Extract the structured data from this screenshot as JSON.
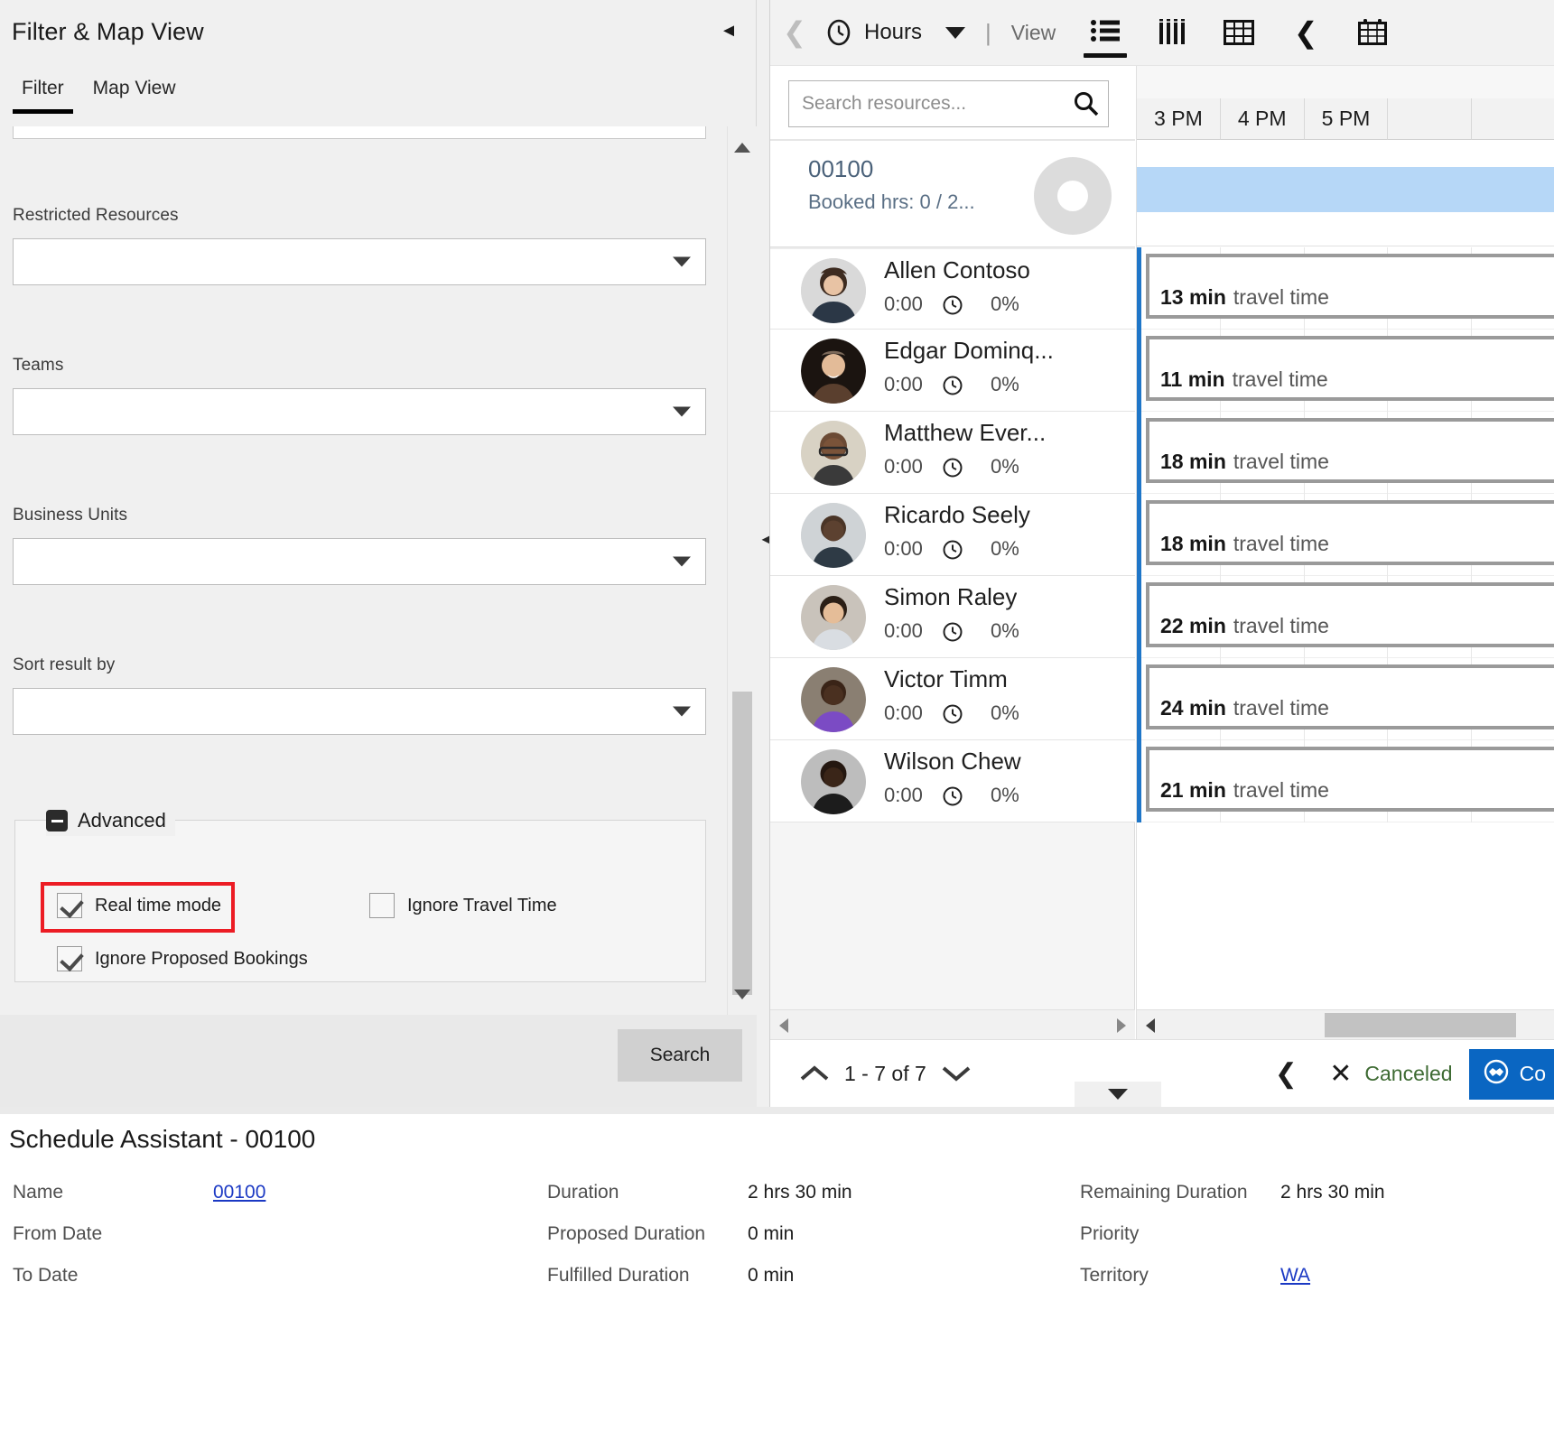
{
  "filter_panel": {
    "title": "Filter & Map View",
    "collapse_icon": "chevron-left-icon",
    "tabs": [
      {
        "label": "Filter",
        "active": true
      },
      {
        "label": "Map View",
        "active": false
      }
    ],
    "fields": [
      {
        "label": "Restricted Resources",
        "value": ""
      },
      {
        "label": "Teams",
        "value": ""
      },
      {
        "label": "Business Units",
        "value": ""
      },
      {
        "label": "Sort result by",
        "value": ""
      }
    ],
    "advanced": {
      "legend": "Advanced",
      "checkboxes": [
        {
          "label": "Real time mode",
          "checked": true,
          "highlighted": true
        },
        {
          "label": "Ignore Travel Time",
          "checked": false,
          "highlighted": false
        },
        {
          "label": "Ignore Proposed Bookings",
          "checked": true,
          "highlighted": false
        }
      ]
    },
    "footer": {
      "search_label": "Search"
    }
  },
  "schedule": {
    "toolbar": {
      "back_icon": "chevron-left-icon",
      "clock_icon": "clock-icon",
      "unit_label": "Hours",
      "dropdown_icon": "chevron-down-icon",
      "separator": "|",
      "view_label": "View",
      "icons": [
        {
          "name": "list-view-icon",
          "selected": true
        },
        {
          "name": "columns-view-icon",
          "selected": false
        },
        {
          "name": "grid-view-icon",
          "selected": false
        },
        {
          "name": "previous-icon",
          "selected": false
        },
        {
          "name": "calendar-icon",
          "selected": false
        }
      ]
    },
    "search": {
      "placeholder": "Search resources...",
      "value": "",
      "icon": "search-icon"
    },
    "requirement": {
      "name": "00100",
      "booked_hours": "Booked hrs: 0 / 2...",
      "avatar_icon": "requirement-avatar-icon"
    },
    "resources": [
      {
        "name": "Allen Contoso",
        "hours": "0:00",
        "percent": "0%",
        "clock_icon": "clock-icon"
      },
      {
        "name": "Edgar Dominq...",
        "hours": "0:00",
        "percent": "0%",
        "clock_icon": "clock-icon"
      },
      {
        "name": "Matthew Ever...",
        "hours": "0:00",
        "percent": "0%",
        "clock_icon": "clock-icon"
      },
      {
        "name": "Ricardo Seely",
        "hours": "0:00",
        "percent": "0%",
        "clock_icon": "clock-icon"
      },
      {
        "name": "Simon Raley",
        "hours": "0:00",
        "percent": "0%",
        "clock_icon": "clock-icon"
      },
      {
        "name": "Victor Timm",
        "hours": "0:00",
        "percent": "0%",
        "clock_icon": "clock-icon"
      },
      {
        "name": "Wilson Chew",
        "hours": "0:00",
        "percent": "0%",
        "clock_icon": "clock-icon"
      }
    ],
    "timeline": {
      "hour_labels": [
        "3 PM",
        "4 PM",
        "5 PM"
      ],
      "travel_blocks": [
        {
          "minutes": "13 min",
          "label": "travel time"
        },
        {
          "minutes": "11 min",
          "label": "travel time"
        },
        {
          "minutes": "18 min",
          "label": "travel time"
        },
        {
          "minutes": "18 min",
          "label": "travel time"
        },
        {
          "minutes": "22 min",
          "label": "travel time"
        },
        {
          "minutes": "24 min",
          "label": "travel time"
        },
        {
          "minutes": "21 min",
          "label": "travel time"
        }
      ],
      "highlight_color": "#b6d7f7",
      "lead_color": "#1f76c8"
    },
    "footer": {
      "up_icon": "chevron-up-icon",
      "paging_text": "1 - 7 of 7",
      "down_icon": "chevron-down-icon",
      "prev_icon": "chevron-left-icon",
      "cancel_icon": "close-icon",
      "cancel_label": "Canceled",
      "confirm_icon": "handshake-icon",
      "confirm_label": "Co"
    }
  },
  "detail": {
    "title": "Schedule Assistant - 00100",
    "columns": [
      {
        "rows": [
          {
            "label": "Name",
            "value": "00100",
            "is_link": true
          },
          {
            "label": "From Date",
            "value": "",
            "is_link": false
          },
          {
            "label": "To Date",
            "value": "",
            "is_link": false
          }
        ]
      },
      {
        "rows": [
          {
            "label": "Duration",
            "value": "2 hrs 30 min",
            "is_link": false
          },
          {
            "label": "Proposed Duration",
            "value": "0 min",
            "is_link": false
          },
          {
            "label": "Fulfilled Duration",
            "value": "0 min",
            "is_link": false
          }
        ]
      },
      {
        "rows": [
          {
            "label": "Remaining Duration",
            "value": "2 hrs 30 min",
            "is_link": false
          },
          {
            "label": "Priority",
            "value": "",
            "is_link": false
          },
          {
            "label": "Territory",
            "value": "WA",
            "is_link": true
          }
        ]
      }
    ]
  }
}
